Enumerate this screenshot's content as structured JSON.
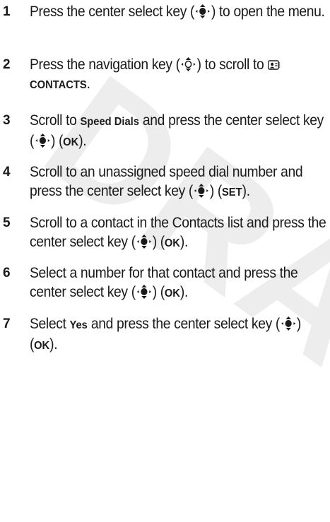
{
  "watermark": "DRAFT",
  "steps": [
    {
      "num": "1",
      "parts": [
        {
          "t": "Press the center select key ("
        },
        {
          "icon": "center-select-key-icon"
        },
        {
          "t": ") to open the menu."
        }
      ]
    },
    {
      "num": "2",
      "parts": [
        {
          "t": "Press the navigation key ("
        },
        {
          "icon": "navigation-key-icon"
        },
        {
          "t": ") to scroll to "
        },
        {
          "icon": "contacts-book-icon"
        },
        {
          "kw": "CONTACTS"
        },
        {
          "t": "."
        }
      ]
    },
    {
      "num": "3",
      "parts": [
        {
          "t": "Scroll to "
        },
        {
          "kw": "Speed Dials"
        },
        {
          "t": " and press the center select key ("
        },
        {
          "icon": "center-select-key-icon"
        },
        {
          "t": ") ("
        },
        {
          "kw": "OK"
        },
        {
          "t": ")."
        }
      ]
    },
    {
      "num": "4",
      "parts": [
        {
          "t": "Scroll to an unassigned speed dial number and press the center select key ("
        },
        {
          "icon": "center-select-key-icon"
        },
        {
          "t": ") ("
        },
        {
          "kw": "SET"
        },
        {
          "t": ")."
        }
      ]
    },
    {
      "num": "5",
      "parts": [
        {
          "t": "Scroll to a contact in the Contacts list and press the center select key ("
        },
        {
          "icon": "center-select-key-icon"
        },
        {
          "t": ") ("
        },
        {
          "kw": "OK"
        },
        {
          "t": ")."
        }
      ]
    },
    {
      "num": "6",
      "parts": [
        {
          "t": "Select a number for that contact and press the center select key ("
        },
        {
          "icon": "center-select-key-icon"
        },
        {
          "t": ") ("
        },
        {
          "kw": "OK"
        },
        {
          "t": ")."
        }
      ]
    },
    {
      "num": "7",
      "parts": [
        {
          "t": "Select "
        },
        {
          "kw": "Yes"
        },
        {
          "t": " and press the center select key ("
        },
        {
          "icon": "center-select-key-icon"
        },
        {
          "t": ") ("
        },
        {
          "kw": "OK"
        },
        {
          "t": ")."
        }
      ]
    }
  ]
}
